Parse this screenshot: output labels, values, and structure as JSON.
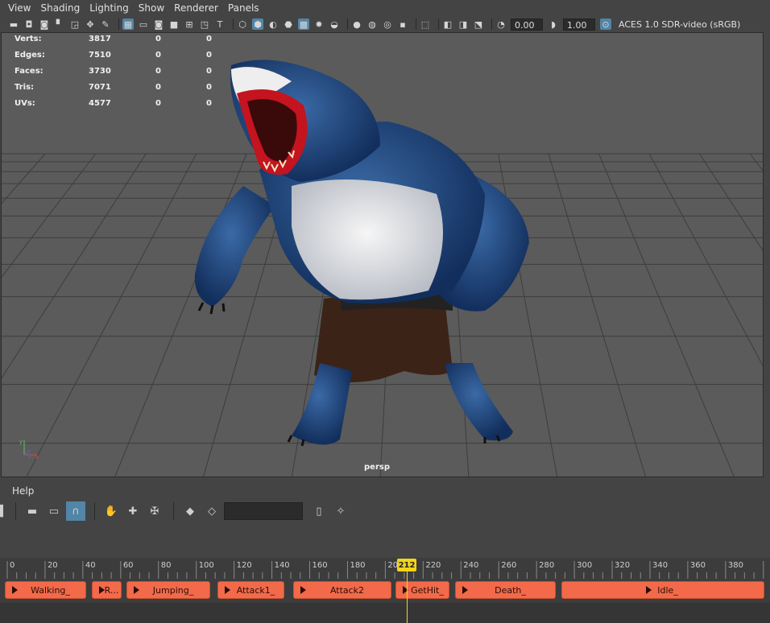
{
  "menu": [
    "View",
    "Shading",
    "Lighting",
    "Show",
    "Renderer",
    "Panels"
  ],
  "toolbar": {
    "exposure_value": "0.00",
    "gamma_value": "1.00",
    "color_transform": "ACES 1.0 SDR-video (sRGB)"
  },
  "hud": {
    "rows": [
      {
        "label": "Verts:",
        "v1": "3817",
        "v2": "0",
        "v3": "0"
      },
      {
        "label": "Edges:",
        "v1": "7510",
        "v2": "0",
        "v3": "0"
      },
      {
        "label": "Faces:",
        "v1": "3730",
        "v2": "0",
        "v3": "0"
      },
      {
        "label": "Tris:",
        "v1": "7071",
        "v2": "0",
        "v3": "0"
      },
      {
        "label": "UVs:",
        "v1": "4577",
        "v2": "0",
        "v3": "0"
      }
    ]
  },
  "viewport": {
    "camera": "persp",
    "bg_color": "#5b5b5b",
    "grid_color": "#3d3d3d"
  },
  "lower": {
    "help": "Help"
  },
  "timeline": {
    "ticks": [
      "0",
      "20",
      "40",
      "60",
      "80",
      "100",
      "120",
      "140",
      "160",
      "180",
      "200",
      "220",
      "240",
      "260",
      "280",
      "300",
      "320",
      "340",
      "360",
      "380"
    ],
    "current_frame": "212",
    "clips": [
      "Walking_",
      "R...",
      "Jumping_",
      "Attack1_",
      "Attack2",
      "GetHit_",
      "Death_",
      "Idle_"
    ],
    "clip_color": "#f26a4a",
    "playhead_color": "#f2d51a"
  }
}
